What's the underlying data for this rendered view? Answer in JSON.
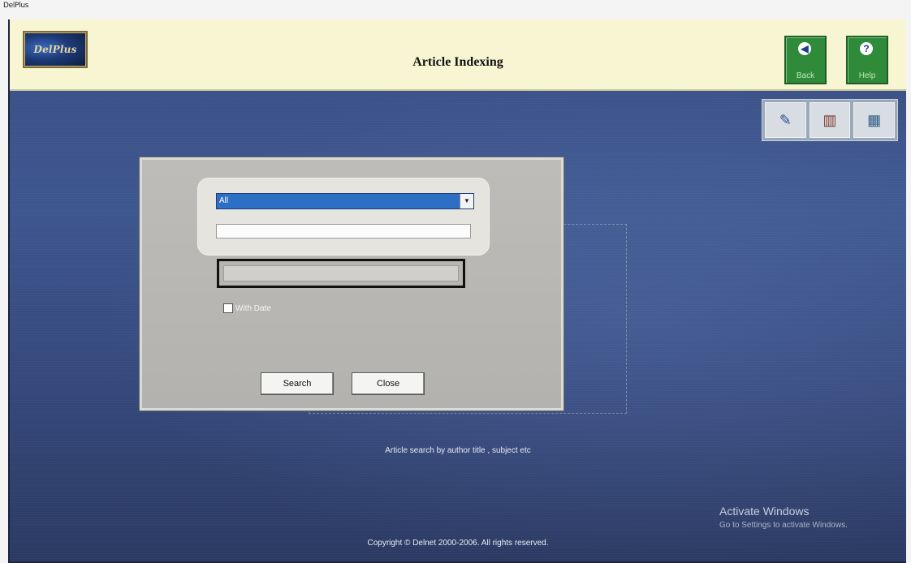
{
  "window": {
    "title": "DelPlus"
  },
  "header": {
    "logo_text": "DelPlus",
    "title": "Article Indexing",
    "back_label": "Back",
    "help_label": "Help",
    "back_icon": "arrow-left-icon",
    "help_icon": "question-icon"
  },
  "toolbar": {
    "tools": [
      {
        "icon": "edit-card-icon"
      },
      {
        "icon": "books-icon"
      },
      {
        "icon": "calculator-icon"
      }
    ]
  },
  "dialog": {
    "search_field_value": "All",
    "search_text_value": "",
    "with_date_label": "With Date",
    "with_date_checked": false,
    "search_button": "Search",
    "close_button": "Close"
  },
  "status_text": "Article search by author title , subject etc",
  "copyright": "Copyright © Delnet 2000-2006. All rights reserved.",
  "watermark": {
    "title": "Activate Windows",
    "subtitle": "Go to Settings to activate Windows."
  },
  "colors": {
    "header_bg": "#f8f6d2",
    "nav_green": "#2f8a3a",
    "selection_blue": "#2e6fc6",
    "desktop_blue": "#3d568d"
  }
}
